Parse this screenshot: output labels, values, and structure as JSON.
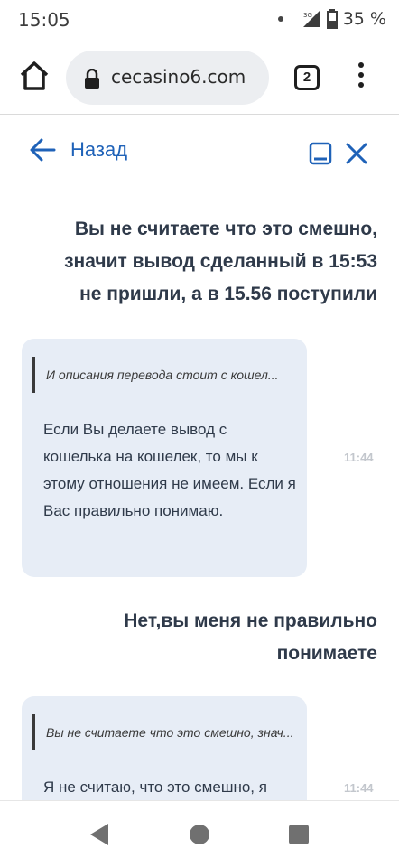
{
  "status_bar": {
    "time": "15:05",
    "network": "3G",
    "battery": "35 %"
  },
  "browser": {
    "url": "cecasino6.com",
    "tab_count": "2"
  },
  "chat_header": {
    "back_label": "Назад"
  },
  "messages": [
    {
      "type": "user",
      "lines": [
        "Вы не считаете что это смешно,",
        "значит вывод сделанный в 15:53",
        "не пришли, а в 15.56 поступили"
      ]
    },
    {
      "type": "operator",
      "quote": "И описания перевода стоит с кошел...",
      "text": "Если Вы делаете вывод с кошелька на кошелек, то мы к этому отношения не имеем. Если я Вас правильно понимаю.",
      "time": "11:44"
    },
    {
      "type": "user",
      "lines": [
        "Нет,вы меня не правильно",
        "понимаете"
      ]
    },
    {
      "type": "operator",
      "quote": "Вы не считаете что это смешно, знач...",
      "text": "Я не считаю, что это смешно, я",
      "time": "11:44"
    }
  ],
  "colors": {
    "accent": "#1f62b8",
    "bubble": "#e7edf6",
    "text": "#2f3a4a",
    "time": "#c3c7cd"
  }
}
